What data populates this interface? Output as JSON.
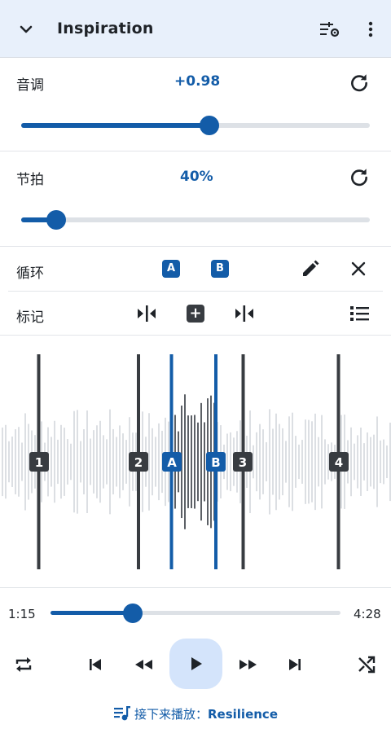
{
  "header": {
    "title": "Inspiration",
    "icons": {
      "collapse": "chevron-down-icon",
      "equalizer": "tune-settings-icon",
      "more": "more-vert-icon"
    }
  },
  "pitch": {
    "label": "音调",
    "value": "+0.98",
    "level_fraction": 0.54
  },
  "tempo": {
    "label": "节拍",
    "value": "40%",
    "level_fraction": 0.1
  },
  "loop": {
    "label": "循环",
    "a_label": "A",
    "b_label": "B"
  },
  "markers": {
    "label": "标记",
    "add_label": "+"
  },
  "waveform": {
    "marker_labels": [
      "1",
      "2",
      "3",
      "4"
    ],
    "loop_labels": [
      "A",
      "B"
    ]
  },
  "player": {
    "elapsed": "1:15",
    "total": "4:28",
    "progress_fraction": 0.285
  },
  "up_next": {
    "prefix": "接下来播放：",
    "track": "Resilience"
  },
  "colors": {
    "accent": "#135ca8",
    "header_bg": "#e8f0fb",
    "play_bg": "#d4e4fb",
    "marker": "#383c41"
  }
}
